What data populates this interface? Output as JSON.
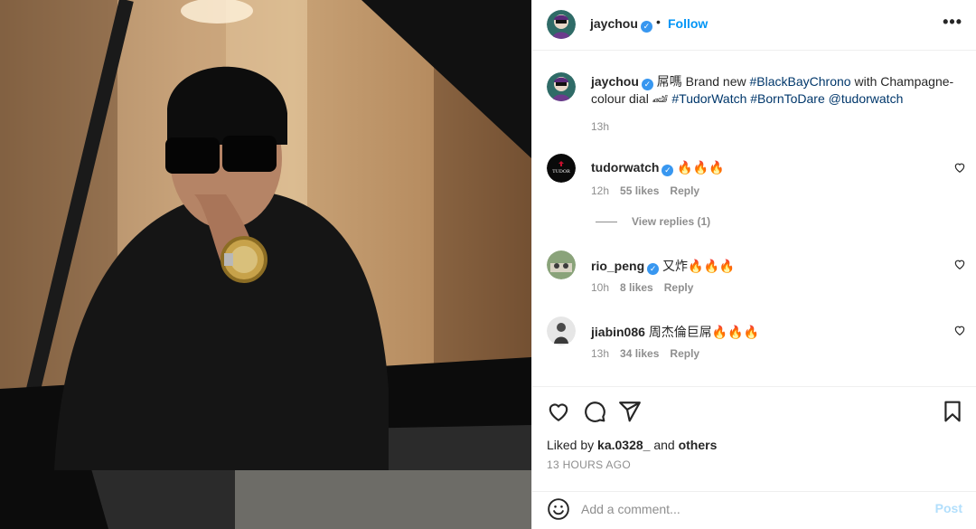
{
  "post": {
    "author": "jaychou",
    "follow_label": "Follow",
    "separator": "•",
    "more_label": "•••"
  },
  "caption": {
    "author": "jaychou",
    "text_before": "屌嗎 Brand new ",
    "tag1": "#BlackBayChrono",
    "text_middle": " with Champagne-colour dial 🏎 ",
    "tag2": "#TudorWatch",
    "tag3": "#BornToDare",
    "mention": "@tudorwatch",
    "time": "13h"
  },
  "comments": [
    {
      "user": "tudorwatch",
      "text": "🔥🔥🔥",
      "time": "12h",
      "likes": "55 likes",
      "reply": "Reply",
      "view_replies": "View replies (1)"
    },
    {
      "user": "rio_peng",
      "text": "又炸🔥🔥🔥",
      "time": "10h",
      "likes": "8 likes",
      "reply": "Reply"
    },
    {
      "user": "jiabin086",
      "text": "周杰倫巨屌🔥🔥🔥",
      "time": "13h",
      "likes": "34 likes",
      "reply": "Reply"
    }
  ],
  "liked_by": {
    "prefix": "Liked by ",
    "user": "ka.0328_",
    "middle": " and ",
    "others": "others"
  },
  "timestamp": "13 HOURS AGO",
  "add_comment": {
    "placeholder": "Add a comment...",
    "post_label": "Post"
  },
  "icons": {
    "like": "heart-icon",
    "comment": "comment-bubble-icon",
    "share": "paper-plane-icon",
    "save": "bookmark-icon",
    "emoji": "smiley-icon",
    "verified": "verified-badge-icon"
  },
  "colors": {
    "link": "#0095f6",
    "tag": "#00376b",
    "verified": "#3897f0",
    "muted": "#8e8e8e",
    "post_disabled": "#b2dffc"
  }
}
